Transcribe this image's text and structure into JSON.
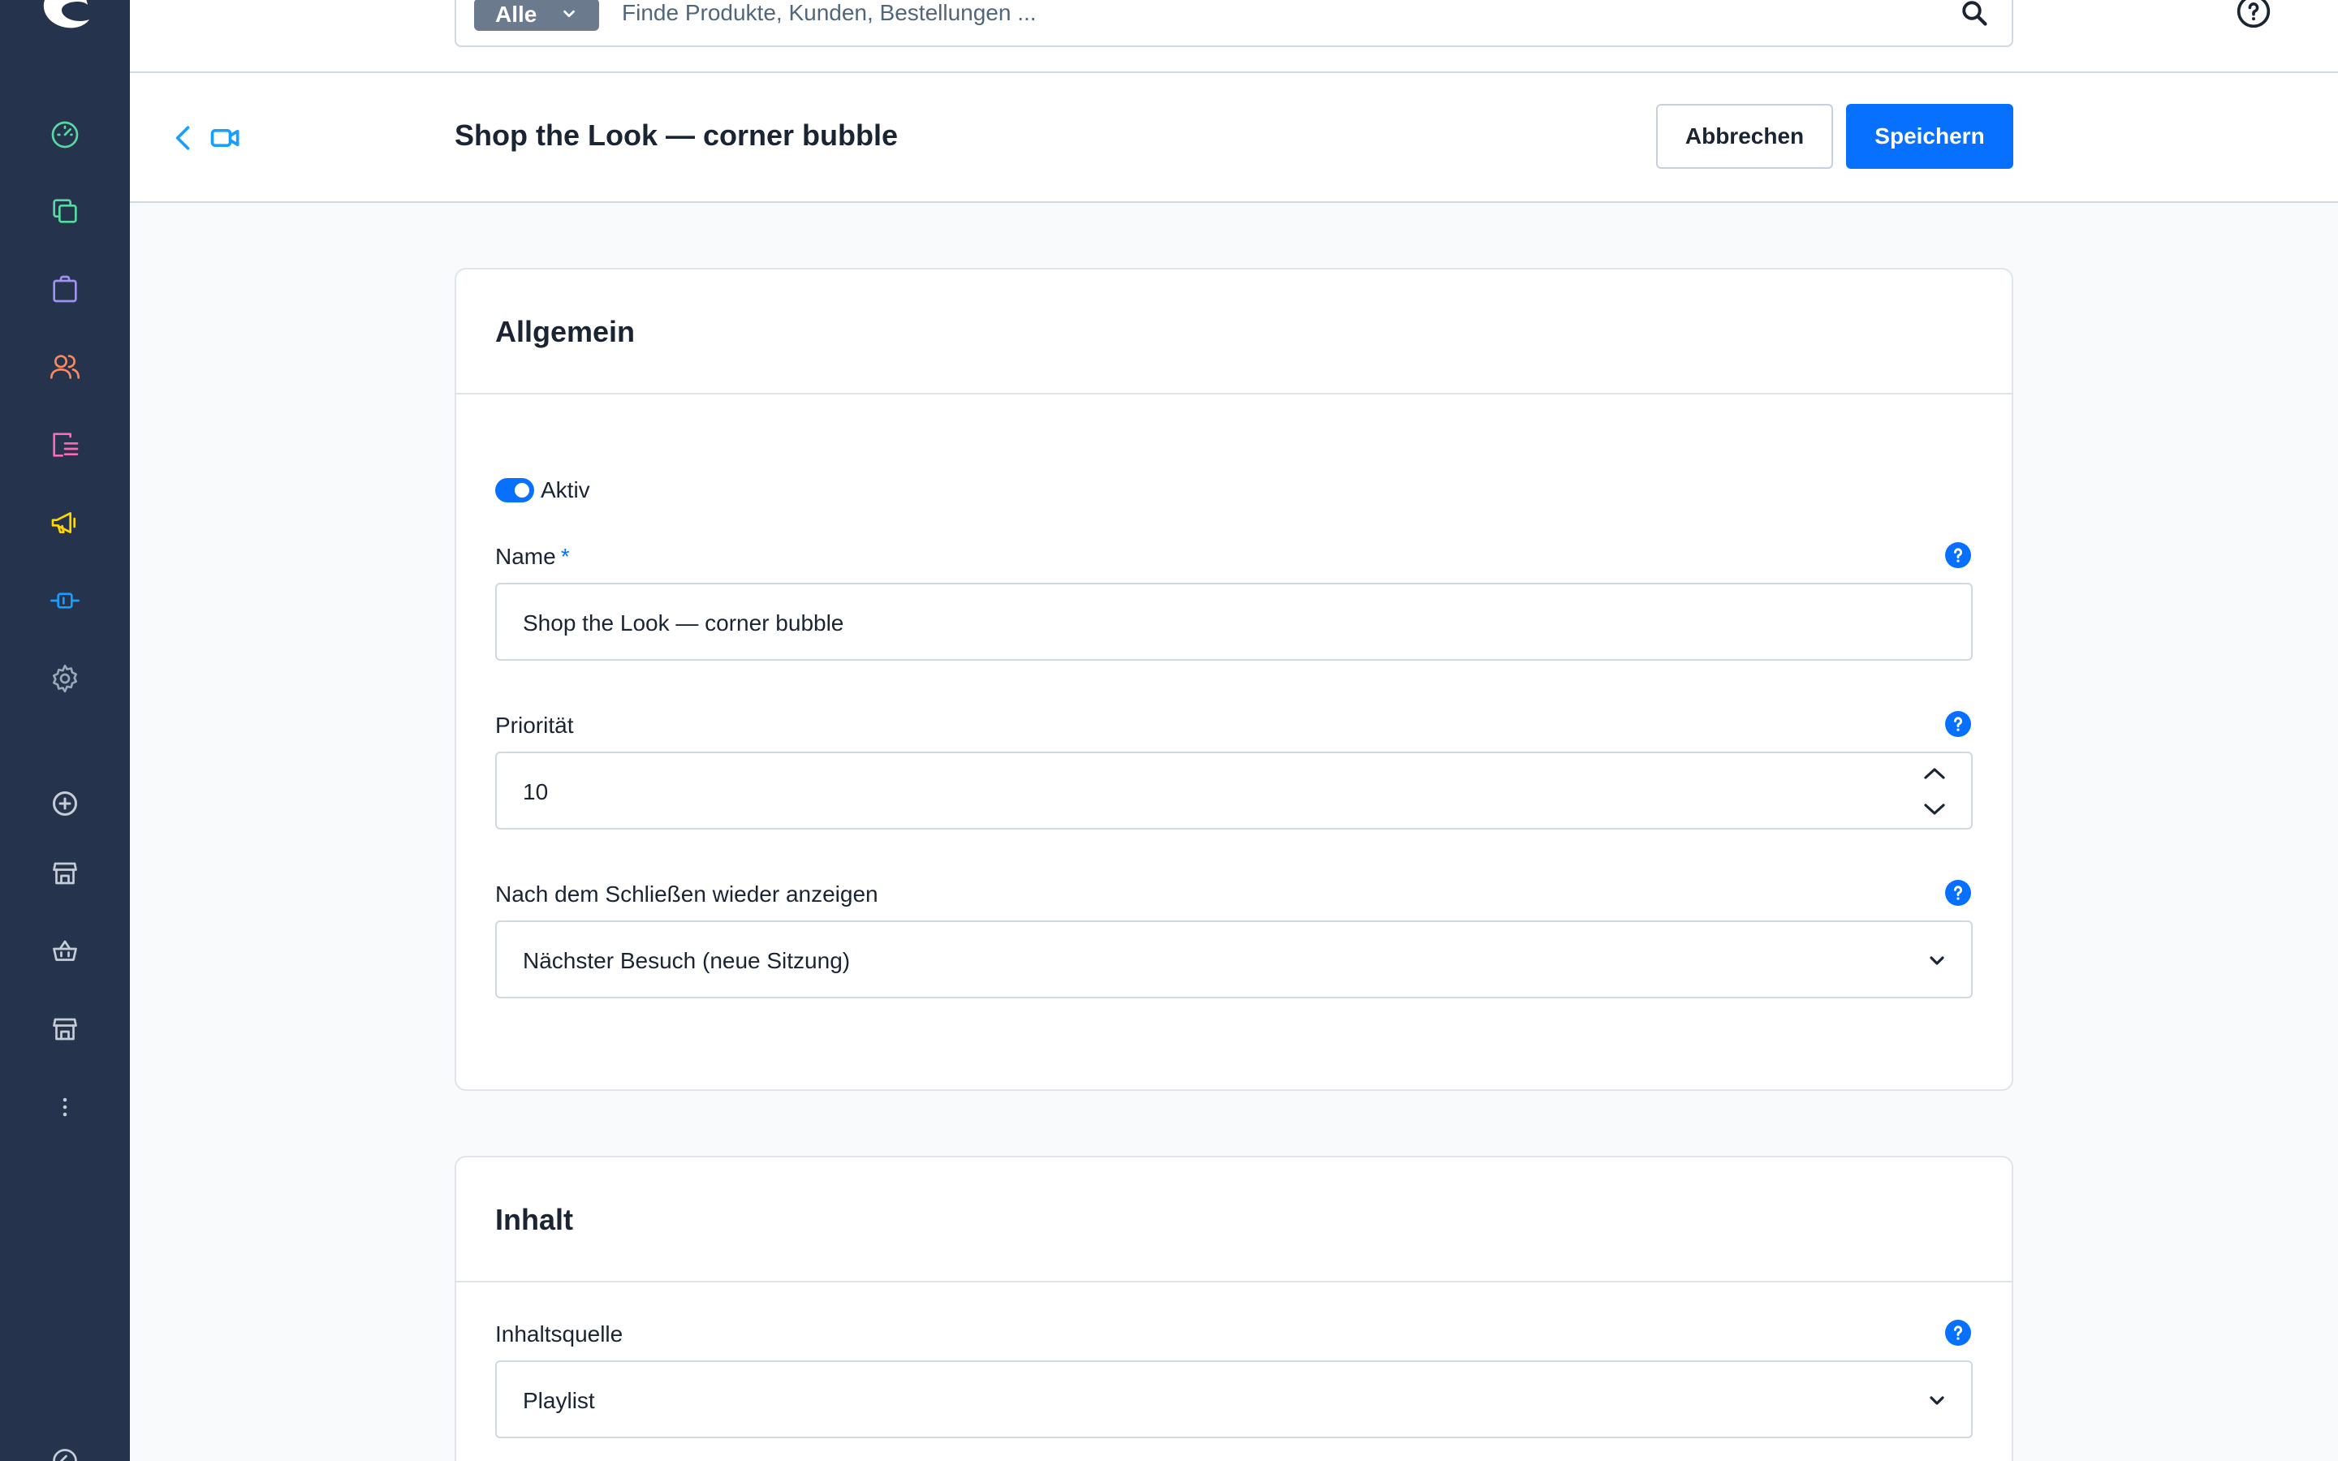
{
  "topbar": {
    "search_type": "Alle",
    "search_placeholder": "Finde Produkte, Kunden, Bestellungen ..."
  },
  "sidebar": {
    "items": [
      {
        "name": "dashboard",
        "color": "#57d9a3"
      },
      {
        "name": "catalogues",
        "color": "#57d9a3"
      },
      {
        "name": "orders",
        "color": "#a092f0"
      },
      {
        "name": "customers",
        "color": "#f88962"
      },
      {
        "name": "content",
        "color": "#ff68b4"
      },
      {
        "name": "marketing",
        "color": "#ffd700"
      },
      {
        "name": "extensions",
        "color": "#189eff"
      },
      {
        "name": "settings",
        "color": "#9aa8b5"
      },
      {
        "name": "add-sales-channel",
        "color": "#c5cdd6"
      },
      {
        "name": "storefront",
        "color": "#c5cdd6"
      },
      {
        "name": "headless",
        "color": "#c5cdd6"
      },
      {
        "name": "storefront-2",
        "color": "#c5cdd6"
      },
      {
        "name": "more",
        "color": "#c5cdd6"
      }
    ]
  },
  "smartbar": {
    "title": "Shop the Look — corner bubble",
    "cancel_label": "Abbrechen",
    "save_label": "Speichern"
  },
  "general_card": {
    "title": "Allgemein",
    "active_label": "Aktiv",
    "active": true,
    "name_label": "Name",
    "name_required_marker": "*",
    "name_value": "Shop the Look — corner bubble",
    "priority_label": "Priorität",
    "priority_value": "10",
    "reshow_label": "Nach dem Schließen wieder anzeigen",
    "reshow_value": "Nächster Besuch (neue Sitzung)"
  },
  "content_card": {
    "title": "Inhalt",
    "source_label": "Inhaltsquelle",
    "source_value": "Playlist"
  },
  "colors": {
    "primary": "#0870ff",
    "sidebar_bg": "#26334d"
  }
}
